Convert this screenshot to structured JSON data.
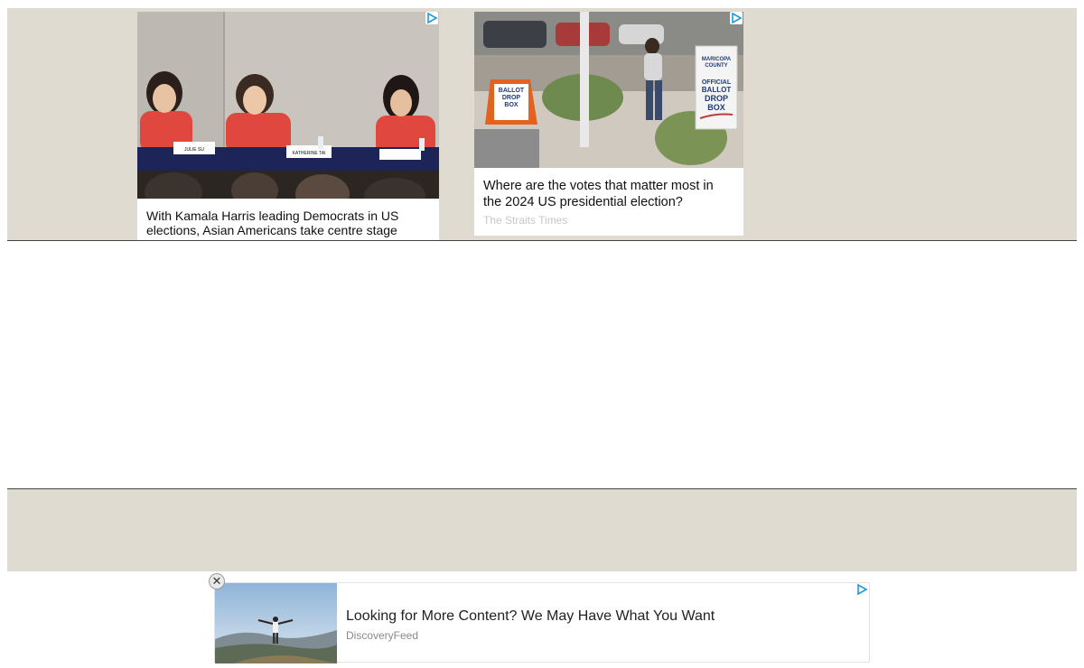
{
  "ads_top": [
    {
      "title": "With Kamala Harris leading Democrats in US elections, Asian Americans take centre stage",
      "image_icon": "panel-discussion-photo",
      "table_nameplates": [
        "JULIE SU",
        "KATHERINE TAI"
      ]
    },
    {
      "title": "Where are the votes that matter most in the 2024 US presidential election?",
      "source": "The Straits Times",
      "image_icon": "ballot-drop-box-photo",
      "sign_left": [
        "BALLOT",
        "DROP",
        "BOX"
      ],
      "sign_right": [
        "MARICOPA",
        "COUNTY",
        "OFFICIAL",
        "BALLOT",
        "DROP",
        "BOX"
      ]
    }
  ],
  "bottom_ad": {
    "title": "Looking for More Content? We May Have What You Want",
    "source": "DiscoveryFeed",
    "close_label": "✕",
    "image_icon": "person-on-mountain-photo"
  },
  "colors": {
    "band": "#dfdbd0",
    "adchoices": "#1a9cd8"
  }
}
